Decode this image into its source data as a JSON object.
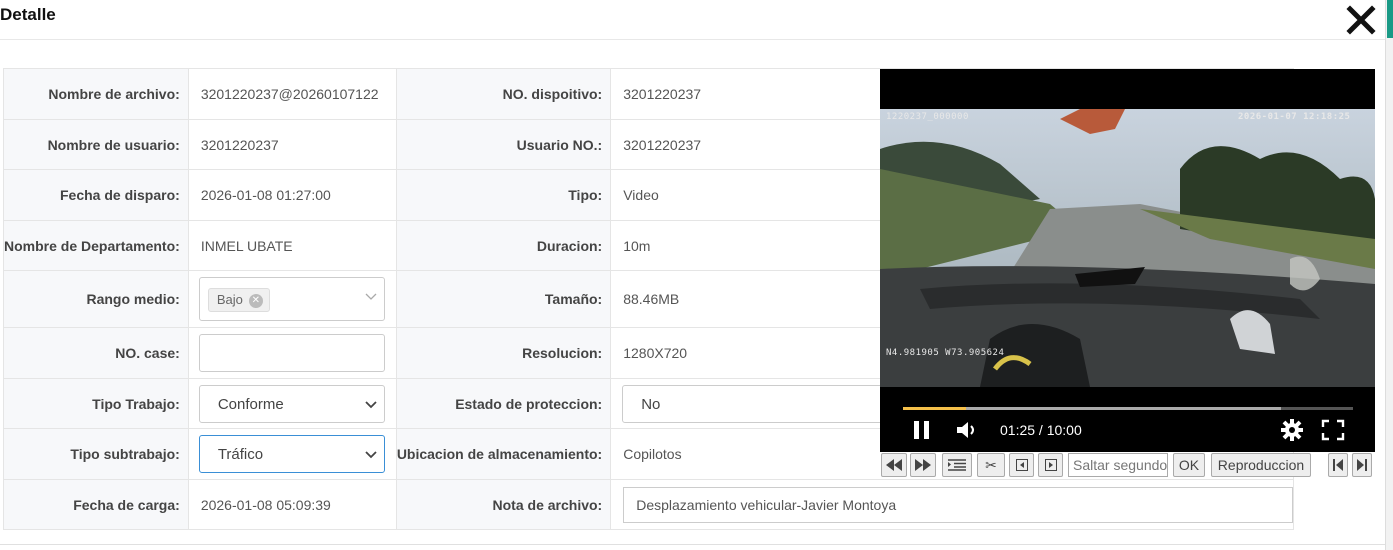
{
  "dialog": {
    "title": "Detalle"
  },
  "form": {
    "nombre_archivo": {
      "label": "Nombre de archivo:",
      "value": "3201220237@20260107122"
    },
    "no_dispositivo": {
      "label": "NO. dispoitivo:",
      "value": "3201220237"
    },
    "nombre_usuario": {
      "label": "Nombre de usuario:",
      "value": "3201220237"
    },
    "usuario_no": {
      "label": "Usuario NO.:",
      "value": "3201220237"
    },
    "fecha_disparo": {
      "label": "Fecha de disparo:",
      "value": "2026-01-08 01:27:00"
    },
    "tipo": {
      "label": "Tipo:",
      "value": "Video"
    },
    "departamento": {
      "label": "Nombre de Departamento:",
      "value": "INMEL UBATE"
    },
    "duracion": {
      "label": "Duracion:",
      "value": "10m"
    },
    "rango_medio": {
      "label": "Rango medio:",
      "tag": "Bajo"
    },
    "tamano": {
      "label": "Tamaño:",
      "value": "88.46MB"
    },
    "no_case": {
      "label": "NO. case:",
      "value": ""
    },
    "resolucion": {
      "label": "Resolucion:",
      "value": "1280X720"
    },
    "tipo_trabajo": {
      "label": "Tipo Trabajo:",
      "value": "Conforme"
    },
    "estado_proteccion": {
      "label": "Estado de proteccion:",
      "value": "No"
    },
    "tipo_subtrabajo": {
      "label": "Tipo subtrabajo:",
      "value": "Tráfico"
    },
    "ubicacion": {
      "label": "Ubicacion de almacenamiento:",
      "value": "Copilotos"
    },
    "fecha_carga": {
      "label": "Fecha de carga:",
      "value": "2026-01-08 05:09:39"
    },
    "nota_archivo": {
      "label": "Nota de archivo:",
      "value": "Desplazamiento vehicular-Javier Montoya"
    }
  },
  "video": {
    "osd_left": "1220237_000000",
    "osd_right": "2026-01-07  12:18:25",
    "gps": "N4.981905  W73.905624",
    "time_display": "01:25 / 10:00",
    "progress_fraction": 0.14,
    "buffered_fraction": 0.84
  },
  "toolbar": {
    "seek_placeholder": "Saltar segundos",
    "ok_label": "OK",
    "playback_label": "Reproduccion"
  },
  "colors": {
    "progress": "#f5c04a",
    "accent_teal": "#1a9a86",
    "focus_border": "#3a8fd6"
  }
}
